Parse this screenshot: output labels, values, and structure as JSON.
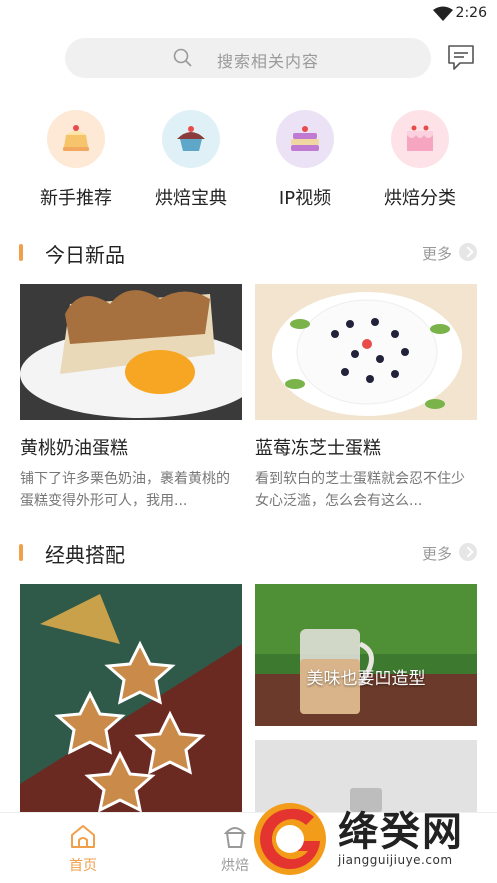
{
  "status": {
    "time": "2:26"
  },
  "search": {
    "placeholder": "搜索相关内容"
  },
  "categories": [
    {
      "label": "新手推荐",
      "icon": "cake-slice-icon",
      "bg": "#fde9d6"
    },
    {
      "label": "烘焙宝典",
      "icon": "cupcake-icon",
      "bg": "#dff1f6"
    },
    {
      "label": "IP视频",
      "icon": "layer-cake-icon",
      "bg": "#ece2f5"
    },
    {
      "label": "烘焙分类",
      "icon": "pink-cake-icon",
      "bg": "#fde2e8"
    }
  ],
  "sections": {
    "new": {
      "title": "今日新品",
      "more": "更多"
    },
    "classic": {
      "title": "经典搭配",
      "more": "更多"
    }
  },
  "new_items": [
    {
      "name": "黄桃奶油蛋糕",
      "desc": "铺下了许多栗色奶油，裹着黄桃的蛋糕变得外形可人，我用..."
    },
    {
      "name": "蓝莓冻芝士蛋糕",
      "desc": "看到软白的芝士蛋糕就会忍不住少女心泛滥，怎么会有这么..."
    }
  ],
  "classic_items": [
    {
      "overlay": "美味也要凹造型"
    }
  ],
  "nav": [
    {
      "label": "首页",
      "active": true
    },
    {
      "label": "烘焙"
    }
  ],
  "colors": {
    "accent": "#f0a04b",
    "nav_active": "#f0a04b"
  },
  "watermark": {
    "brand": "绛癸网",
    "url": "jiangguijiuye.com"
  }
}
